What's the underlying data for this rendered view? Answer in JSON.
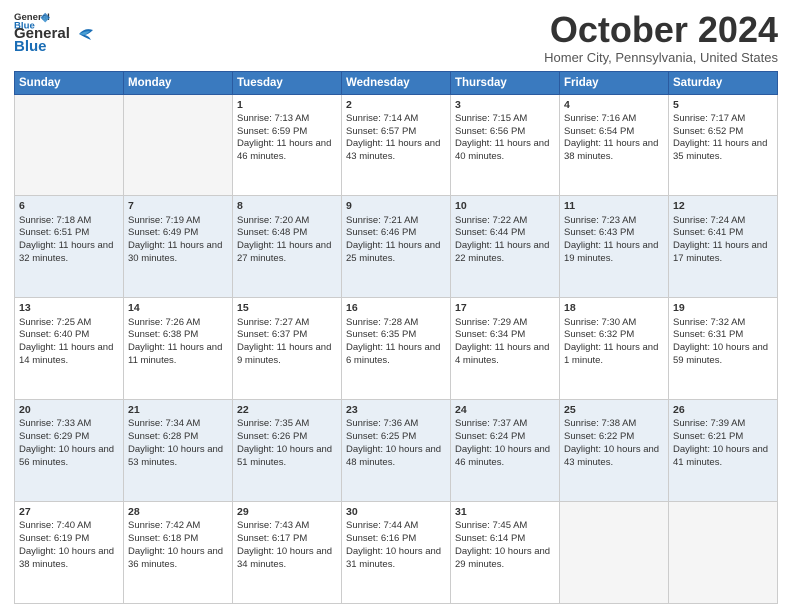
{
  "header": {
    "logo_line1": "General",
    "logo_line2": "Blue",
    "month": "October 2024",
    "location": "Homer City, Pennsylvania, United States"
  },
  "days_of_week": [
    "Sunday",
    "Monday",
    "Tuesday",
    "Wednesday",
    "Thursday",
    "Friday",
    "Saturday"
  ],
  "weeks": [
    [
      {
        "day": "",
        "empty": true
      },
      {
        "day": "",
        "empty": true
      },
      {
        "day": "1",
        "sunrise": "Sunrise: 7:13 AM",
        "sunset": "Sunset: 6:59 PM",
        "daylight": "Daylight: 11 hours and 46 minutes."
      },
      {
        "day": "2",
        "sunrise": "Sunrise: 7:14 AM",
        "sunset": "Sunset: 6:57 PM",
        "daylight": "Daylight: 11 hours and 43 minutes."
      },
      {
        "day": "3",
        "sunrise": "Sunrise: 7:15 AM",
        "sunset": "Sunset: 6:56 PM",
        "daylight": "Daylight: 11 hours and 40 minutes."
      },
      {
        "day": "4",
        "sunrise": "Sunrise: 7:16 AM",
        "sunset": "Sunset: 6:54 PM",
        "daylight": "Daylight: 11 hours and 38 minutes."
      },
      {
        "day": "5",
        "sunrise": "Sunrise: 7:17 AM",
        "sunset": "Sunset: 6:52 PM",
        "daylight": "Daylight: 11 hours and 35 minutes."
      }
    ],
    [
      {
        "day": "6",
        "sunrise": "Sunrise: 7:18 AM",
        "sunset": "Sunset: 6:51 PM",
        "daylight": "Daylight: 11 hours and 32 minutes."
      },
      {
        "day": "7",
        "sunrise": "Sunrise: 7:19 AM",
        "sunset": "Sunset: 6:49 PM",
        "daylight": "Daylight: 11 hours and 30 minutes."
      },
      {
        "day": "8",
        "sunrise": "Sunrise: 7:20 AM",
        "sunset": "Sunset: 6:48 PM",
        "daylight": "Daylight: 11 hours and 27 minutes."
      },
      {
        "day": "9",
        "sunrise": "Sunrise: 7:21 AM",
        "sunset": "Sunset: 6:46 PM",
        "daylight": "Daylight: 11 hours and 25 minutes."
      },
      {
        "day": "10",
        "sunrise": "Sunrise: 7:22 AM",
        "sunset": "Sunset: 6:44 PM",
        "daylight": "Daylight: 11 hours and 22 minutes."
      },
      {
        "day": "11",
        "sunrise": "Sunrise: 7:23 AM",
        "sunset": "Sunset: 6:43 PM",
        "daylight": "Daylight: 11 hours and 19 minutes."
      },
      {
        "day": "12",
        "sunrise": "Sunrise: 7:24 AM",
        "sunset": "Sunset: 6:41 PM",
        "daylight": "Daylight: 11 hours and 17 minutes."
      }
    ],
    [
      {
        "day": "13",
        "sunrise": "Sunrise: 7:25 AM",
        "sunset": "Sunset: 6:40 PM",
        "daylight": "Daylight: 11 hours and 14 minutes."
      },
      {
        "day": "14",
        "sunrise": "Sunrise: 7:26 AM",
        "sunset": "Sunset: 6:38 PM",
        "daylight": "Daylight: 11 hours and 11 minutes."
      },
      {
        "day": "15",
        "sunrise": "Sunrise: 7:27 AM",
        "sunset": "Sunset: 6:37 PM",
        "daylight": "Daylight: 11 hours and 9 minutes."
      },
      {
        "day": "16",
        "sunrise": "Sunrise: 7:28 AM",
        "sunset": "Sunset: 6:35 PM",
        "daylight": "Daylight: 11 hours and 6 minutes."
      },
      {
        "day": "17",
        "sunrise": "Sunrise: 7:29 AM",
        "sunset": "Sunset: 6:34 PM",
        "daylight": "Daylight: 11 hours and 4 minutes."
      },
      {
        "day": "18",
        "sunrise": "Sunrise: 7:30 AM",
        "sunset": "Sunset: 6:32 PM",
        "daylight": "Daylight: 11 hours and 1 minute."
      },
      {
        "day": "19",
        "sunrise": "Sunrise: 7:32 AM",
        "sunset": "Sunset: 6:31 PM",
        "daylight": "Daylight: 10 hours and 59 minutes."
      }
    ],
    [
      {
        "day": "20",
        "sunrise": "Sunrise: 7:33 AM",
        "sunset": "Sunset: 6:29 PM",
        "daylight": "Daylight: 10 hours and 56 minutes."
      },
      {
        "day": "21",
        "sunrise": "Sunrise: 7:34 AM",
        "sunset": "Sunset: 6:28 PM",
        "daylight": "Daylight: 10 hours and 53 minutes."
      },
      {
        "day": "22",
        "sunrise": "Sunrise: 7:35 AM",
        "sunset": "Sunset: 6:26 PM",
        "daylight": "Daylight: 10 hours and 51 minutes."
      },
      {
        "day": "23",
        "sunrise": "Sunrise: 7:36 AM",
        "sunset": "Sunset: 6:25 PM",
        "daylight": "Daylight: 10 hours and 48 minutes."
      },
      {
        "day": "24",
        "sunrise": "Sunrise: 7:37 AM",
        "sunset": "Sunset: 6:24 PM",
        "daylight": "Daylight: 10 hours and 46 minutes."
      },
      {
        "day": "25",
        "sunrise": "Sunrise: 7:38 AM",
        "sunset": "Sunset: 6:22 PM",
        "daylight": "Daylight: 10 hours and 43 minutes."
      },
      {
        "day": "26",
        "sunrise": "Sunrise: 7:39 AM",
        "sunset": "Sunset: 6:21 PM",
        "daylight": "Daylight: 10 hours and 41 minutes."
      }
    ],
    [
      {
        "day": "27",
        "sunrise": "Sunrise: 7:40 AM",
        "sunset": "Sunset: 6:19 PM",
        "daylight": "Daylight: 10 hours and 38 minutes."
      },
      {
        "day": "28",
        "sunrise": "Sunrise: 7:42 AM",
        "sunset": "Sunset: 6:18 PM",
        "daylight": "Daylight: 10 hours and 36 minutes."
      },
      {
        "day": "29",
        "sunrise": "Sunrise: 7:43 AM",
        "sunset": "Sunset: 6:17 PM",
        "daylight": "Daylight: 10 hours and 34 minutes."
      },
      {
        "day": "30",
        "sunrise": "Sunrise: 7:44 AM",
        "sunset": "Sunset: 6:16 PM",
        "daylight": "Daylight: 10 hours and 31 minutes."
      },
      {
        "day": "31",
        "sunrise": "Sunrise: 7:45 AM",
        "sunset": "Sunset: 6:14 PM",
        "daylight": "Daylight: 10 hours and 29 minutes."
      },
      {
        "day": "",
        "empty": true
      },
      {
        "day": "",
        "empty": true
      }
    ]
  ]
}
